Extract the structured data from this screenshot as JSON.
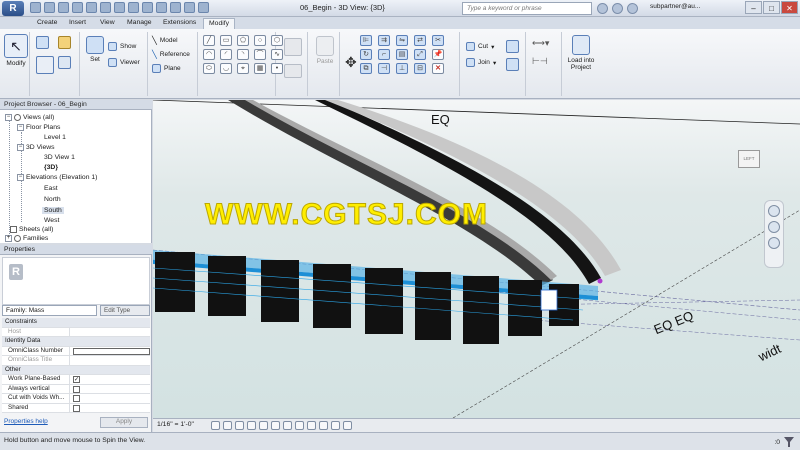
{
  "app": {
    "button": "R",
    "title": "06_Begin - 3D View: {3D}",
    "search_placeholder": "Type a keyword or phrase",
    "user": "subpartner@au..."
  },
  "tabs": [
    "Create",
    "Insert",
    "View",
    "Manage",
    "Extensions",
    "Modify"
  ],
  "active_tab": "Modify",
  "ribbon": {
    "modify_label": "Modify",
    "set_label": "Set",
    "show_label": "Show",
    "viewer_label": "Viewer",
    "model_label": "Model",
    "reference_label": "Reference",
    "plane_label": "Plane",
    "paste_label": "Paste",
    "cut_label": "Cut",
    "join_label": "Join",
    "load_project_label": "Load into Project"
  },
  "project_browser": {
    "title": "Project Browser - 06_Begin",
    "items": [
      {
        "label": "Views (all)",
        "toggle": "−"
      },
      {
        "label": "Floor Plans",
        "toggle": "−"
      },
      {
        "label": "Level 1"
      },
      {
        "label": "3D Views",
        "toggle": "−"
      },
      {
        "label": "3D View 1"
      },
      {
        "label": "{3D}"
      },
      {
        "label": "Elevations (Elevation 1)",
        "toggle": "−"
      },
      {
        "label": "East"
      },
      {
        "label": "North"
      },
      {
        "label": "South"
      },
      {
        "label": "West"
      },
      {
        "label": "Sheets (all)"
      },
      {
        "label": "Families",
        "toggle": "+"
      }
    ]
  },
  "properties": {
    "title": "Properties",
    "type_icon": "R",
    "family": "Family: Mass",
    "edit_type": "Edit Type",
    "groups": {
      "constraints": "Constraints",
      "identity": "Identity Data",
      "other": "Other"
    },
    "rows": {
      "host": "Host",
      "omniclass_number": "OmniClass Number",
      "omniclass_title": "OmniClass Title",
      "work_plane_based": "Work Plane-Based",
      "always_vertical": "Always vertical",
      "cut_with_voids": "Cut with Voids Wh...",
      "shared": "Shared"
    },
    "work_plane_based_check": "✓",
    "help_link": "Properties help",
    "apply": "Apply"
  },
  "viewport": {
    "watermark": "WWW.CGTSJ.COM",
    "eq_top": "EQ",
    "eq_bottom": "EQ EQ",
    "width_partial": "widt",
    "viewcube_label": "LEFT"
  },
  "view_control": {
    "scale": "1/16\" = 1'-0\""
  },
  "status": {
    "text": "Hold button and move mouse to Spin the View.",
    "counter": ":0"
  },
  "colors": {
    "accent": "#2b4e88",
    "watermark": "#ffee00",
    "highlight_blue": "#1d8fd6",
    "mass_black": "#111111"
  }
}
